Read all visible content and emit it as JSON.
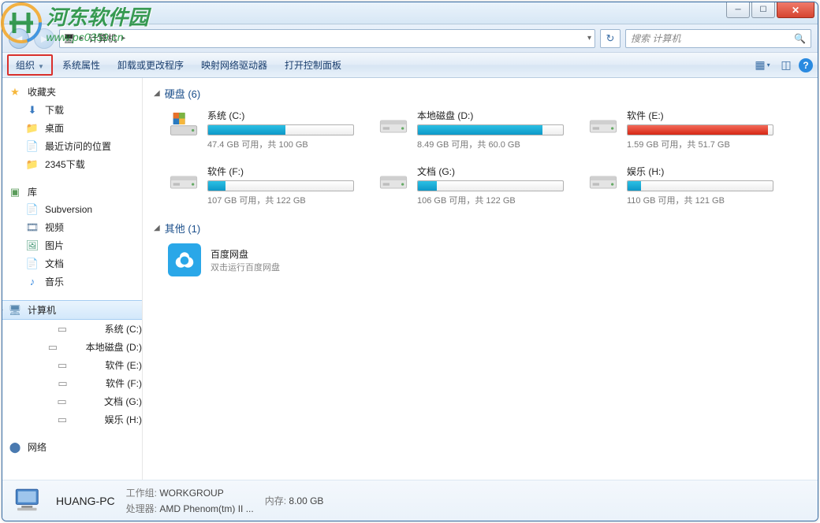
{
  "watermark": {
    "line1": "河东软件园",
    "line2": "www.pc0359.cn"
  },
  "address": {
    "location": "计算机",
    "chevron": "▸"
  },
  "search": {
    "placeholder": "搜索 计算机"
  },
  "toolbar": {
    "organize": "组织",
    "properties": "系统属性",
    "uninstall": "卸载或更改程序",
    "mapdrive": "映射网络驱动器",
    "controlpanel": "打开控制面板"
  },
  "sidebar": {
    "favorites": {
      "label": "收藏夹",
      "items": [
        {
          "icon": "dl",
          "label": "下载"
        },
        {
          "icon": "folder",
          "label": "桌面"
        },
        {
          "icon": "doc",
          "label": "最近访问的位置"
        },
        {
          "icon": "folder",
          "label": "2345下载"
        }
      ]
    },
    "libraries": {
      "label": "库",
      "items": [
        {
          "icon": "doc",
          "label": "Subversion"
        },
        {
          "icon": "vid",
          "label": "视频"
        },
        {
          "icon": "pic",
          "label": "图片"
        },
        {
          "icon": "doc",
          "label": "文档"
        },
        {
          "icon": "mus",
          "label": "音乐"
        }
      ]
    },
    "computer": {
      "label": "计算机",
      "items": [
        {
          "label": "系统 (C:)"
        },
        {
          "label": "本地磁盘 (D:)"
        },
        {
          "label": "软件 (E:)"
        },
        {
          "label": "软件 (F:)"
        },
        {
          "label": "文档 (G:)"
        },
        {
          "label": "娱乐 (H:)"
        }
      ]
    },
    "network": {
      "label": "网络"
    }
  },
  "content": {
    "cat_drives": "硬盘 (6)",
    "cat_other": "其他 (1)",
    "drives": [
      {
        "name": "系统 (C:)",
        "free": "47.4 GB 可用，共 100 GB",
        "pct": 53,
        "red": false,
        "sys": true
      },
      {
        "name": "本地磁盘 (D:)",
        "free": "8.49 GB 可用，共 60.0 GB",
        "pct": 86,
        "red": false,
        "sys": false
      },
      {
        "name": "软件 (E:)",
        "free": "1.59 GB 可用，共 51.7 GB",
        "pct": 97,
        "red": true,
        "sys": false
      },
      {
        "name": "软件 (F:)",
        "free": "107 GB 可用，共 122 GB",
        "pct": 12,
        "red": false,
        "sys": false
      },
      {
        "name": "文档 (G:)",
        "free": "106 GB 可用，共 122 GB",
        "pct": 13,
        "red": false,
        "sys": false
      },
      {
        "name": "娱乐 (H:)",
        "free": "110 GB 可用，共 121 GB",
        "pct": 9,
        "red": false,
        "sys": false
      }
    ],
    "other": {
      "name": "百度网盘",
      "desc": "双击运行百度网盘"
    }
  },
  "status": {
    "pcname": "HUANG-PC",
    "workgroup_label": "工作组:",
    "workgroup_value": "WORKGROUP",
    "cpu_label": "处理器:",
    "cpu_value": "AMD Phenom(tm) II ...",
    "mem_label": "内存:",
    "mem_value": "8.00 GB"
  }
}
